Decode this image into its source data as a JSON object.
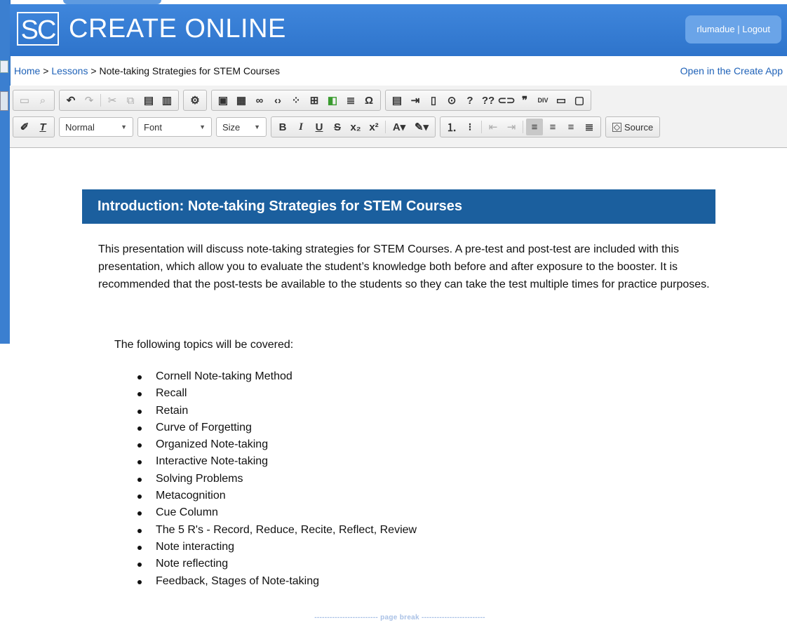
{
  "header": {
    "logo_mark": "SC",
    "app_title": "CREATE ONLINE",
    "username": "rlumadue",
    "separator": "|",
    "logout_label": "Logout"
  },
  "breadcrumb": {
    "home": "Home",
    "sep1": ">",
    "lessons": "Lessons",
    "sep2": ">",
    "current": "Note-taking Strategies for STEM Courses",
    "open_app": "Open in the Create App"
  },
  "toolbar": {
    "format_value": "Normal",
    "font_value": "Font",
    "size_value": "Size",
    "source_label": "Source",
    "icons_row1": [
      "save-icon",
      "preview-icon",
      "undo-icon",
      "redo-icon",
      "cut-icon",
      "copy-icon",
      "paste-icon",
      "paste-text-icon",
      "settings-icon",
      "image-icon",
      "flash-icon",
      "link-icon",
      "embed-code-icon",
      "plugin-icon",
      "table-icon",
      "book-icon",
      "horizontal-line-icon",
      "special-char-icon",
      "template-icon",
      "indent-block-icon",
      "document-icon",
      "play-icon",
      "question-icon",
      "double-question-icon",
      "anchor-icon",
      "quote-icon",
      "div-icon",
      "hr-box-icon",
      "page-icon"
    ],
    "icons_row2": [
      "clear-format-icon",
      "remove-format-icon",
      "bold-icon",
      "italic-icon",
      "underline-icon",
      "strike-icon",
      "subscript-icon",
      "superscript-icon",
      "text-color-icon",
      "highlight-icon",
      "numbered-list-icon",
      "bullet-list-icon",
      "outdent-icon",
      "indent-icon",
      "align-left-icon",
      "align-center-icon",
      "align-right-icon",
      "justify-icon",
      "source-icon"
    ]
  },
  "content": {
    "intro_title": "Introduction: Note-taking Strategies for STEM Courses",
    "intro_paragraph": "This presentation will discuss note-taking strategies for STEM Courses.  A pre-test and post-test are included with this presentation, which allow you to evaluate the student’s knowledge both before and after exposure to the booster. It is recommended that the post-tests be available to the students so they can take the test multiple times for practice purposes.",
    "topics_intro": "The following topics will be covered:",
    "topics": [
      "Cornell Note-taking Method",
      "Recall",
      "Retain",
      "Curve of Forgetting",
      "Organized Note-taking",
      "Interactive Note-taking",
      "Solving Problems",
      "Metacognition",
      "Cue Column",
      "The 5 R's - Record, Reduce, Recite, Reflect, Review",
      "Note interacting",
      "Note reflecting",
      "Feedback, Stages of Note-taking"
    ],
    "page_break": "------------------------- page break -------------------------"
  }
}
